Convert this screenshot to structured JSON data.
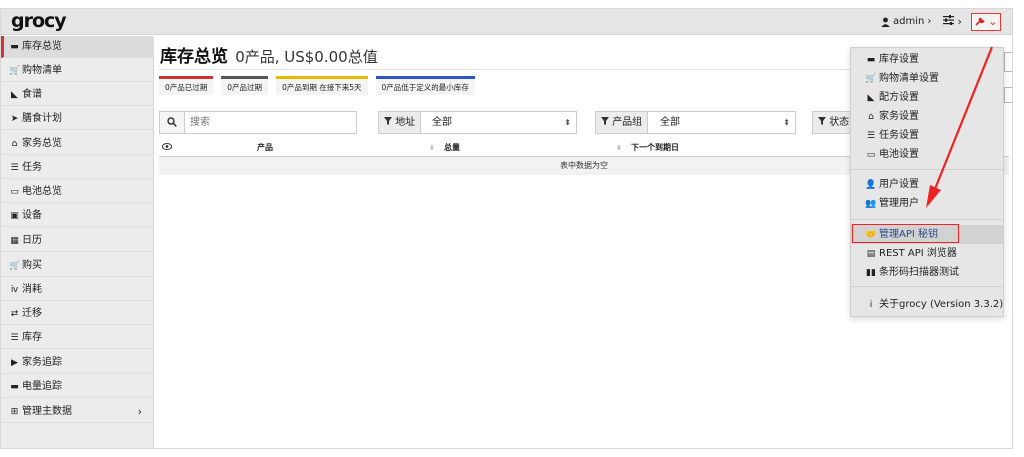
{
  "app": {
    "logo": "grocy"
  },
  "navbar": {
    "user_label": "admin",
    "user_chevron": "›",
    "settings_chevron": "›",
    "wrench_caret": "⌄"
  },
  "sidebar": {
    "items": [
      {
        "label": "库存总览",
        "icon": "box-icon",
        "glyph": "▬"
      },
      {
        "label": "购物清单",
        "icon": "cart-icon",
        "glyph": "🛒"
      },
      {
        "label": "食谱",
        "icon": "pizza-icon",
        "glyph": "◣"
      },
      {
        "label": "膳食计划",
        "icon": "paper-plane-icon",
        "glyph": "➤"
      },
      {
        "label": "家务总览",
        "icon": "home-icon",
        "glyph": "⌂"
      },
      {
        "label": "任务",
        "icon": "tasks-icon",
        "glyph": "☰"
      },
      {
        "label": "电池总览",
        "icon": "battery-icon",
        "glyph": "▭"
      },
      {
        "label": "设备",
        "icon": "toolbox-icon",
        "glyph": "▣"
      },
      {
        "label": "日历",
        "icon": "calendar-icon",
        "glyph": "▦"
      },
      {
        "label": "购买",
        "icon": "cart-plus-icon",
        "glyph": "🛒"
      },
      {
        "label": "消耗",
        "icon": "utensils-icon",
        "glyph": "ⅳ"
      },
      {
        "label": "迁移",
        "icon": "exchange-icon",
        "glyph": "⇄"
      },
      {
        "label": "库存",
        "icon": "list-icon",
        "glyph": "☰"
      },
      {
        "label": "家务追踪",
        "icon": "play-icon",
        "glyph": "▶"
      },
      {
        "label": "电量追踪",
        "icon": "car-battery-icon",
        "glyph": "▬"
      },
      {
        "label": "管理主数据",
        "icon": "table-icon",
        "glyph": "⊞",
        "chevron": "›"
      }
    ]
  },
  "main": {
    "title": "库存总览",
    "subtitle": "0产品, US$0.00总值",
    "badges": [
      {
        "label": "0产品已过期"
      },
      {
        "label": "0产品过期"
      },
      {
        "label": "0产品到期 在接下来5天"
      },
      {
        "label": "0产品低于定义的最小库存"
      }
    ],
    "search": {
      "placeholder": "搜索"
    },
    "filters": {
      "location": {
        "label": "地址",
        "value": "全部"
      },
      "product_group": {
        "label": "产品组",
        "value": "全部"
      },
      "status": {
        "label": "状态"
      }
    },
    "table": {
      "columns": [
        "产品",
        "总量",
        "下一个到期日"
      ],
      "empty_text": "表中数据为空"
    }
  },
  "dropdown": {
    "items": [
      {
        "label": "库存设置",
        "icon": "box-icon",
        "glyph": "▬"
      },
      {
        "label": "购物清单设置",
        "icon": "cart-icon",
        "glyph": "🛒"
      },
      {
        "label": "配方设置",
        "icon": "pizza-icon",
        "glyph": "◣"
      },
      {
        "label": "家务设置",
        "icon": "home-icon",
        "glyph": "⌂"
      },
      {
        "label": "任务设置",
        "icon": "tasks-icon",
        "glyph": "☰"
      },
      {
        "label": "电池设置",
        "icon": "battery-icon",
        "glyph": "▭"
      },
      {
        "label": "用户设置",
        "icon": "user-cog-icon",
        "glyph": "👤"
      },
      {
        "label": "管理用户",
        "icon": "users-icon",
        "glyph": "👥"
      },
      {
        "label": "管理API 秘钥",
        "icon": "handshake-icon",
        "glyph": "🤝",
        "highlight": true
      },
      {
        "label": "REST API 浏览器",
        "icon": "book-icon",
        "glyph": "▤"
      },
      {
        "label": "条形码扫描器测试",
        "icon": "barcode-icon",
        "glyph": "▮▮"
      },
      {
        "label": "关于grocy (Version 3.3.2)",
        "icon": "info-icon",
        "glyph": "i"
      }
    ]
  },
  "colors": {
    "accent_red": "#cc3333",
    "badge_grey": "#555555",
    "badge_yellow": "#e6b800",
    "badge_blue": "#2a56c6",
    "annotation_red": "#ee2222"
  }
}
